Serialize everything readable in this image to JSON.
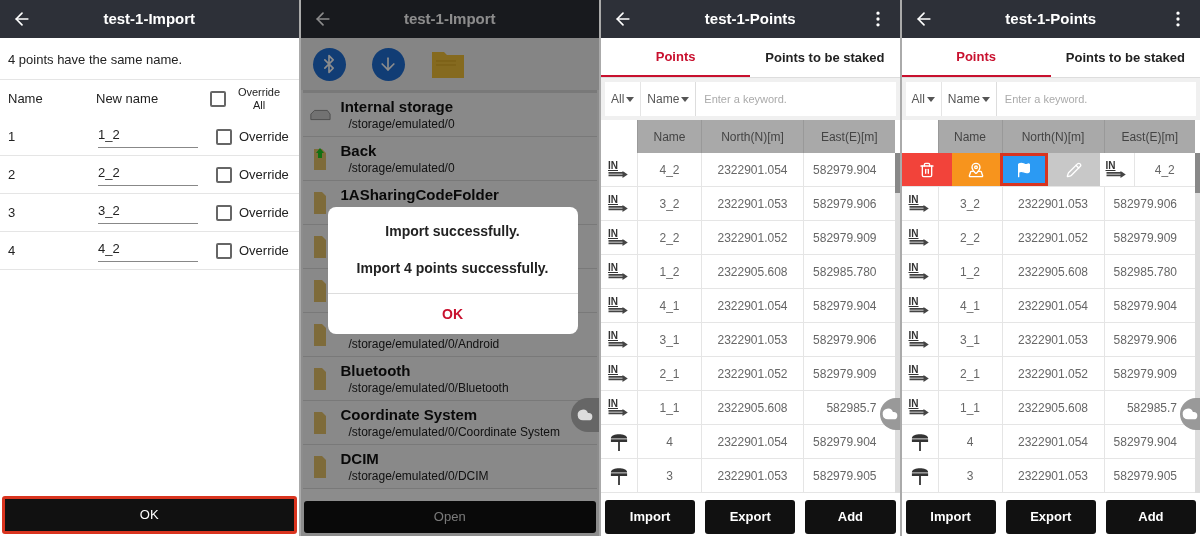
{
  "import_screen": {
    "title": "test-1-Import",
    "message": "4 points have the same name.",
    "columns": [
      "Name",
      "New name"
    ],
    "override_all": {
      "label": "Override All",
      "checked": false
    },
    "rows": [
      {
        "name": "1",
        "new_name": "1_2",
        "override_label": "Override",
        "checked": false
      },
      {
        "name": "2",
        "new_name": "2_2",
        "override_label": "Override",
        "checked": false
      },
      {
        "name": "3",
        "new_name": "3_2",
        "override_label": "Override",
        "checked": false
      },
      {
        "name": "4",
        "new_name": "4_2",
        "override_label": "Override",
        "checked": false
      }
    ],
    "ok_button": {
      "label": "OK",
      "highlighted": true
    }
  },
  "browser_screen": {
    "title": "test-1-Import",
    "items": [
      {
        "kind": "drive",
        "name": "Internal storage",
        "path": "/storage/emulated/0"
      },
      {
        "kind": "back",
        "name": "Back",
        "path": "/storage/emulated/0"
      },
      {
        "kind": "folder",
        "name": "1ASharingCodeFolder"
      },
      {
        "kind": "folder"
      },
      {
        "kind": "folder"
      },
      {
        "kind": "folder",
        "path": "/storage/emulated/0/Android"
      },
      {
        "kind": "folder",
        "name": "Bluetooth",
        "path": "/storage/emulated/0/Bluetooth"
      },
      {
        "kind": "folder",
        "name": "Coordinate System",
        "path": "/storage/emulated/0/Coordinate System"
      },
      {
        "kind": "folder",
        "name": "DCIM",
        "path": "/storage/emulated/0/DCIM"
      }
    ],
    "open_button": "Open",
    "dialog": {
      "title": "Import successfully.",
      "message": "Import 4 points successfully.",
      "button": "OK"
    }
  },
  "points_screens": [
    {
      "title": "test-1-Points",
      "tabs": [
        {
          "label": "Points",
          "selected": true
        },
        {
          "label": "Points to be staked",
          "selected": false
        }
      ],
      "filters": [
        "All",
        "Name"
      ],
      "search": {
        "placeholder": "Enter a keyword."
      },
      "columns": [
        "Name",
        "North(N)[m]",
        "East(E)[m]"
      ],
      "rows": [
        {
          "kind": "imported",
          "badge": "IN",
          "name": "4_2",
          "north": "2322901.054",
          "east": "582979.904"
        },
        {
          "kind": "imported",
          "badge": "IN",
          "name": "3_2",
          "north": "2322901.053",
          "east": "582979.906"
        },
        {
          "kind": "imported",
          "badge": "IN",
          "name": "2_2",
          "north": "2322901.052",
          "east": "582979.909"
        },
        {
          "kind": "imported",
          "badge": "IN",
          "name": "1_2",
          "north": "2322905.608",
          "east": "582985.780"
        },
        {
          "kind": "imported",
          "badge": "IN",
          "name": "4_1",
          "north": "2322901.054",
          "east": "582979.904"
        },
        {
          "kind": "imported",
          "badge": "IN",
          "name": "3_1",
          "north": "2322901.053",
          "east": "582979.906"
        },
        {
          "kind": "imported",
          "badge": "IN",
          "name": "2_1",
          "north": "2322901.052",
          "east": "582979.909"
        },
        {
          "kind": "imported",
          "badge": "IN",
          "name": "1_1",
          "north": "2322905.608",
          "east": "582985.7"
        },
        {
          "kind": "measured",
          "name": "4",
          "north": "2322901.054",
          "east": "582979.904"
        },
        {
          "kind": "measured",
          "name": "3",
          "north": "2322901.053",
          "east": "582979.905"
        }
      ],
      "buttons": [
        "Import",
        "Export",
        "Add"
      ]
    },
    {
      "title": "test-1-Points",
      "tabs": [
        {
          "label": "Points",
          "selected": true
        },
        {
          "label": "Points to be staked",
          "selected": false
        }
      ],
      "filters": [
        "All",
        "Name"
      ],
      "search": {
        "placeholder": "Enter a keyword."
      },
      "columns": [
        "Name",
        "North(N)[m]",
        "East(E)[m]"
      ],
      "swiped_row": {
        "badge": "IN",
        "name": "4_2",
        "actions": [
          {
            "kind": "delete",
            "highlighted": false
          },
          {
            "kind": "map",
            "highlighted": false
          },
          {
            "kind": "stake",
            "highlighted": true
          },
          {
            "kind": "edit",
            "highlighted": false
          }
        ]
      },
      "rows": [
        {
          "kind": "imported",
          "badge": "IN",
          "name": "3_2",
          "north": "2322901.053",
          "east": "582979.906"
        },
        {
          "kind": "imported",
          "badge": "IN",
          "name": "2_2",
          "north": "2322901.052",
          "east": "582979.909"
        },
        {
          "kind": "imported",
          "badge": "IN",
          "name": "1_2",
          "north": "2322905.608",
          "east": "582985.780"
        },
        {
          "kind": "imported",
          "badge": "IN",
          "name": "4_1",
          "north": "2322901.054",
          "east": "582979.904"
        },
        {
          "kind": "imported",
          "badge": "IN",
          "name": "3_1",
          "north": "2322901.053",
          "east": "582979.906"
        },
        {
          "kind": "imported",
          "badge": "IN",
          "name": "2_1",
          "north": "2322901.052",
          "east": "582979.909"
        },
        {
          "kind": "imported",
          "badge": "IN",
          "name": "1_1",
          "north": "2322905.608",
          "east": "582985.7"
        },
        {
          "kind": "measured",
          "name": "4",
          "north": "2322901.054",
          "east": "582979.904"
        },
        {
          "kind": "measured",
          "name": "3",
          "north": "2322901.053",
          "east": "582979.905"
        }
      ],
      "buttons": [
        "Import",
        "Export",
        "Add"
      ]
    }
  ]
}
